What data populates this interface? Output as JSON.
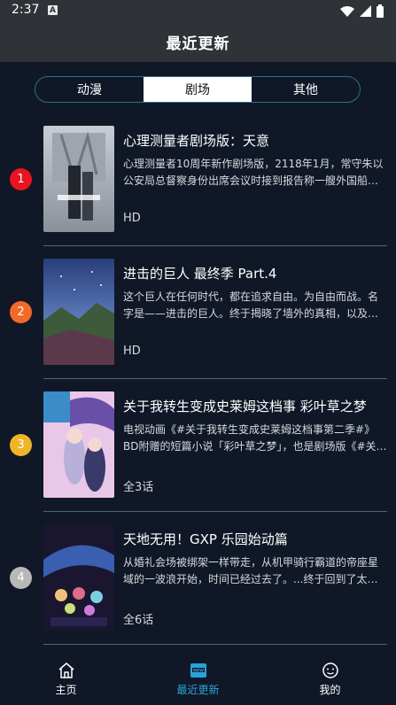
{
  "status": {
    "time": "2:37",
    "notif_glyph": "A"
  },
  "header": {
    "title": "最近更新"
  },
  "tabs": [
    {
      "label": "动漫",
      "active": false
    },
    {
      "label": "剧场",
      "active": true
    },
    {
      "label": "其他",
      "active": false
    }
  ],
  "items": [
    {
      "rank": "1",
      "rank_color": "#e8141f",
      "title": "心理测量者剧场版：天意",
      "desc": "心理测量者10周年新作剧场版，2118年1月，常守朱以公安局总督察身份出席会议时接到报告称一艘外国船只发...",
      "badge": "HD"
    },
    {
      "rank": "2",
      "rank_color": "#f26a2a",
      "title": "进击的巨人 最终季 Part.4",
      "desc": "这个巨人在任何时代，都在追求自由。为自由而战。名字是——进击的巨人。终于揭晓了墙外的真相，以及巨...",
      "badge": "HD"
    },
    {
      "rank": "3",
      "rank_color": "#f0b429",
      "title": "关于我转生变成史莱姆这档事 彩叶草之梦",
      "desc": "电视动画《#关于我转生变成史莱姆这档事第二季#》BD附赠的短篇小说「彩叶草之梦」，也是剧场版《#关于...",
      "badge": "全3话"
    },
    {
      "rank": "4",
      "rank_color": "#b8b8b8",
      "title": "天地无用！GXP 乐园始动篇",
      "desc": "从婚礼会场被绑架一样带走，从机甲骑行霸道的帝座星域的一波浪开始，时间已经过去了。...终于回到了太阳...",
      "badge": "全6话"
    }
  ],
  "nav": [
    {
      "label": "主页",
      "icon": "home-icon",
      "active": false
    },
    {
      "label": "最近更新",
      "icon": "new-icon",
      "active": true
    },
    {
      "label": "我的",
      "icon": "profile-icon",
      "active": false
    }
  ],
  "colors": {
    "accent": "#29a3d9",
    "background": "#101827",
    "bar": "#2f3338"
  }
}
